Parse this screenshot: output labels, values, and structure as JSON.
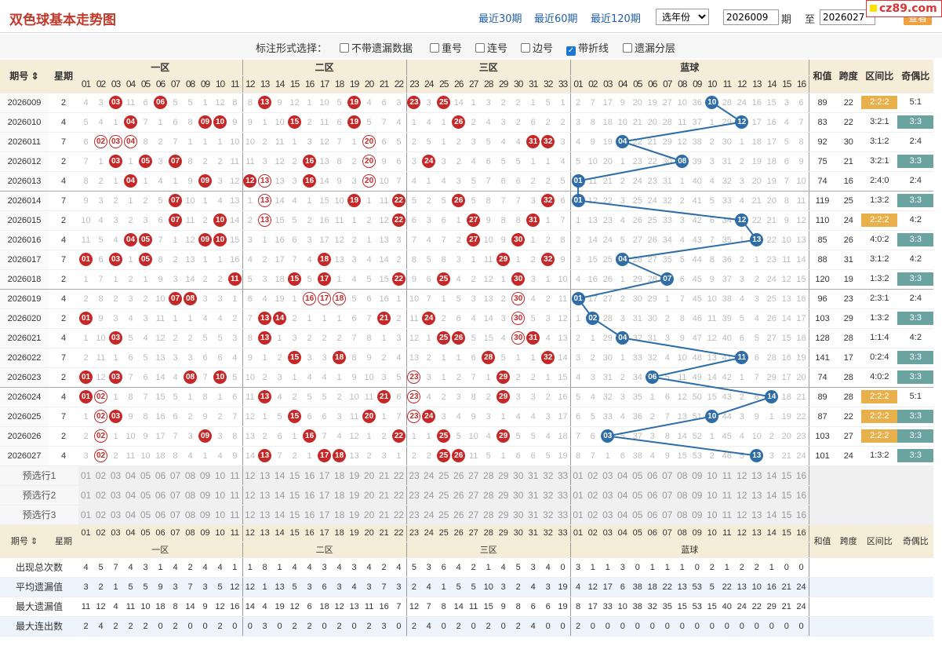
{
  "title": "双色球基本走势图",
  "nav": [
    "最近30期",
    "最近60期",
    "最近120期"
  ],
  "year_select": "选年份",
  "from": "2026009",
  "period_label": "期",
  "to_label": "至",
  "to": "2026027",
  "view": "查看",
  "site": "cz89.com",
  "opts": {
    "label": "标注形式选择：",
    "items": [
      [
        "不带遗漏数据",
        false
      ],
      [
        "重号",
        false
      ],
      [
        "连号",
        false
      ],
      [
        "边号",
        false
      ],
      [
        "带折线",
        true
      ],
      [
        "遗漏分层",
        false
      ]
    ]
  },
  "head": {
    "issue": "期号",
    "week": "星期",
    "zone1": "一区",
    "zone2": "二区",
    "zone3": "三区",
    "blue": "蓝球",
    "sum": "和值",
    "span": "跨度",
    "zone": "区间比",
    "odd": "奇偶比"
  },
  "rows": [
    {
      "i": "2026009",
      "w": "2",
      "r": "4 3 (03) 11 6 (06) 5 5 1 12 8 8 (13) 9 12 1 10 5 (19) 4 6 3 (23) 3 (25) 14 1 3 2 2 1 5 1",
      "b": "2 7 17 9 20 19 27 10 36 (10) 28 24 16 15 3 6",
      "s": "89",
      "sp": "22",
      "z": "2:2:2",
      "zg": 1,
      "o": "5:1",
      "og": 0
    },
    {
      "i": "2026010",
      "w": "4",
      "r": "5 4 1 (04) 7 1 6 8 (09) (10) 9 9 1 10 (15) 2 11 6 (19) 5 7 4 1 4 1 (26) 2 4 3 2 6 2 2",
      "b": "3 8 18 10 21 20 28 11 37 1 29 (12) 17 16 4 7",
      "s": "83",
      "sp": "22",
      "z": "3:2:1",
      "zg": 0,
      "o": "3:3",
      "og": 1
    },
    {
      "i": "2026011",
      "w": "7",
      "r": "6 [02] [03] [04] 8 2 7 1 1 1 10 10 2 11 1 3 12 7 1 [20] 6 5 2 5 1 2 3 5 4 4 (31) (32) 3",
      "b": "4 9 19 (04) 22 21 29 12 38 2 30 1 18 17 5 8",
      "s": "92",
      "sp": "30",
      "z": "3:1:2",
      "zg": 0,
      "o": "2:4",
      "og": 0
    },
    {
      "i": "2026012",
      "w": "2",
      "r": "7 1 (03) 1 (05) 3 (07) 8 2 2 11 11 3 12 2 (16) 13 8 2 [20] 9 6 3 (24) 3 2 4 6 5 5 1 1 4",
      "b": "5 10 20 1 23 22 30 (08) 39 3 31 2 19 18 6 9",
      "s": "75",
      "sp": "21",
      "z": "3:2:1",
      "zg": 0,
      "o": "3:3",
      "og": 1
    },
    {
      "i": "2026013",
      "w": "4",
      "r": "8 2 1 (04) 1 4 1 9 (09) 3 12 (12) [13] 13 3 (16) 14 9 3 [20] 10 7 4 1 4 3 5 7 6 6 2 2 5",
      "b": "(01) 11 21 2 24 23 31 1 40 4 32 3 20 19 7 10",
      "s": "74",
      "sp": "16",
      "z": "2:4:0",
      "zg": 0,
      "o": "2:4",
      "og": 0
    },
    {
      "i": "2026014",
      "w": "7",
      "r": "9 3 2 1 2 5 (07) 10 1 4 13 1 [13] 14 4 1 15 10 (19) 1 11 (22) 5 2 5 (26) 5 8 7 7 3 (32) 6",
      "b": "(01) 12 22 3 25 24 32 2 41 5 33 4 21 20 8 11",
      "s": "119",
      "sp": "25",
      "z": "1:3:2",
      "zg": 0,
      "o": "3:3",
      "og": 1
    },
    {
      "i": "2026015",
      "w": "2",
      "r": "10 4 3 2 3 6 (07) 11 2 (10) 14 2 [13] 15 5 2 16 11 1 2 12 (22) 6 3 6 1 (27) 9 8 8 (31) 1 7",
      "b": "1 13 23 4 26 25 33 3 42 6 34 (12) 22 21 9 12",
      "s": "110",
      "sp": "24",
      "z": "2:2:2",
      "zg": 1,
      "o": "4:2",
      "og": 0
    },
    {
      "i": "2026016",
      "w": "4",
      "r": "11 5 4 (04) (05) 7 1 12 (09) (10) 15 3 1 16 6 3 17 12 2 1 13 3 7 4 7 2 (27) 10 9 (30) 1 2 8",
      "b": "2 14 24 5 27 26 34 4 43 7 35 1 (13) 22 10 13",
      "s": "85",
      "sp": "26",
      "z": "4:0:2",
      "zg": 0,
      "o": "3:3",
      "og": 1
    },
    {
      "i": "2026017",
      "w": "7",
      "r": "(01) 6 (03) 1 (05) 8 2 13 1 1 16 4 2 17 7 4 (18) 13 3 4 14 2 8 5 8 3 1 11 (29) 1 2 (32) 9",
      "b": "3 15 25 (04) 28 27 35 5 44 8 36 2 1 23 11 14",
      "s": "88",
      "sp": "31",
      "z": "3:1:2",
      "zg": 0,
      "o": "4:2",
      "og": 0
    },
    {
      "i": "2026018",
      "w": "2",
      "r": "1 7 1 2 1 9 3 14 2 2 (11) 5 3 18 (15) 5 (17) 1 4 5 15 (22) 9 6 (25) 4 2 12 1 (30) 3 1 10",
      "b": "4 16 26 1 29 28 (07) 6 45 9 37 3 2 24 12 15",
      "s": "120",
      "sp": "19",
      "z": "1:3:2",
      "zg": 0,
      "o": "3:3",
      "og": 1
    },
    {
      "i": "2026019",
      "w": "4",
      "r": "2 8 2 3 2 10 (07) (08) 3 3 1 6 4 19 1 [16] [17] [18] 5 6 16 1 10 7 1 5 3 13 2 [30] 4 2 11",
      "b": "(01) 17 27 2 30 29 1 7 45 10 38 4 3 25 13 16",
      "s": "96",
      "sp": "23",
      "z": "2:3:1",
      "zg": 0,
      "o": "2:4",
      "og": 0
    },
    {
      "i": "2026020",
      "w": "2",
      "r": "(01) 9 3 4 3 11 1 1 4 4 2 7 (13) (14) 2 1 1 1 6 7 (21) 2 11 (24) 2 6 4 14 3 [30] 5 3 12",
      "b": "1 (02) 28 3 31 30 2 8 46 11 39 5 4 26 14 17",
      "s": "103",
      "sp": "29",
      "z": "1:3:2",
      "zg": 0,
      "o": "3:3",
      "og": 1
    },
    {
      "i": "2026021",
      "w": "4",
      "r": "1 10 (03) 5 4 12 2 2 5 5 3 8 (13) 1 3 2 2 2 7 8 1 3 12 1 (25) (26) 5 15 4 [30] (31) 4 13",
      "b": "2 1 29 (04) 32 31 3 9 47 12 40 6 5 27 15 18",
      "s": "128",
      "sp": "28",
      "z": "1:1:4",
      "zg": 0,
      "o": "4:2",
      "og": 0
    },
    {
      "i": "2026022",
      "w": "7",
      "r": "2 11 1 6 5 13 3 3 6 6 4 9 1 2 (15) 3 3 (18) 8 9 2 4 13 2 1 1 6 (28) 5 1 1 (32) 14",
      "b": "3 2 30 1 33 32 4 10 48 13 41 (11) 6 28 16 19",
      "s": "141",
      "sp": "17",
      "z": "0:2:4",
      "zg": 0,
      "o": "3:3",
      "og": 1
    },
    {
      "i": "2026023",
      "w": "2",
      "r": "(01) 12 (03) 7 6 14 4 (08) 7 (10) 5 10 2 3 1 4 4 1 9 10 3 5 [23] 3 1 2 7 1 (29) 2 2 1 15",
      "b": "4 3 31 2 34 (06) 5 11 49 14 42 1 7 29 17 20",
      "s": "74",
      "sp": "28",
      "z": "4:0:2",
      "zg": 0,
      "o": "3:3",
      "og": 1
    },
    {
      "i": "2026024",
      "w": "4",
      "r": "(01) [02] 1 8 7 15 5 1 8 1 6 11 (13) 4 2 5 5 2 10 11 (21) 6 [23] 4 2 3 8 2 (29) 3 3 2 16",
      "b": "5 4 32 3 35 1 6 12 50 15 43 2 8 (14) 18 21",
      "s": "89",
      "sp": "28",
      "z": "2:2:2",
      "zg": 1,
      "o": "5:1",
      "og": 0
    },
    {
      "i": "2026025",
      "w": "7",
      "r": "1 [02] (03) 9 8 16 6 2 9 2 7 12 1 5 (15) 6 6 3 11 (20) 1 7 [23] (24) 3 4 9 3 1 4 4 3 17",
      "b": "6 5 33 4 36 2 7 13 51 (10) 44 3 9 1 19 22",
      "s": "87",
      "sp": "22",
      "z": "2:2:2",
      "zg": 1,
      "o": "3:3",
      "og": 1
    },
    {
      "i": "2026026",
      "w": "2",
      "r": "2 [02] 1 10 9 17 7 3 (09) 3 8 13 2 6 1 (16) 7 4 12 1 2 (22) 1 1 (25) 5 10 4 (29) 5 5 4 18",
      "b": "7 6 (03) 5 37 3 8 14 52 1 45 4 10 2 20 23",
      "s": "103",
      "sp": "27",
      "z": "2:2:2",
      "zg": 1,
      "o": "3:3",
      "og": 1
    },
    {
      "i": "2026027",
      "w": "4",
      "r": "3 [02] 2 11 10 18 8 4 1 4 9 14 (13) 7 2 1 (17) (18) 13 2 3 1 2 2 (25) (26) 11 5 1 6 6 5 19",
      "b": "8 7 1 6 38 4 9 15 53 2 46 5 (13) 3 21 24",
      "s": "101",
      "sp": "24",
      "z": "1:3:2",
      "zg": 0,
      "o": "3:3",
      "og": 1
    }
  ],
  "pick_labels": [
    "预选行1",
    "预选行2",
    "预选行3"
  ],
  "stats": [
    {
      "label": "出现总次数",
      "r": "4 5 7 4 3 1 4 2 4 4 1 1 8 1 4 4 3 4 3 4 2 4 5 3 6 4 2 1 4 5 3 4 0",
      "b": "3 1 1 3 0 1 1 1 0 2 1 2 2 1 0 0"
    },
    {
      "label": "平均遗漏值",
      "r": "3 2 1 5 5 9 3 7 3 5 12 12 1 13 5 3 6 3 4 3 7 3 2 4 1 5 5 10 3 2 4 3 19",
      "b": "4 12 17 6 38 18 22 13 53 5 22 13 10 16 21 24"
    },
    {
      "label": "最大遗漏值",
      "r": "11 12 4 11 10 18 8 14 9 12 16 14 4 19 12 6 18 12 13 11 16 7 12 7 8 14 11 15 9 8 6 6 19",
      "b": "8 17 33 10 38 32 35 15 53 15 40 24 22 29 21 24"
    },
    {
      "label": "最大连出数",
      "r": "2 4 2 2 2 0 2 0 0 2 0 0 3 0 2 2 0 2 0 2 3 0 2 4 0 2 0 2 0 2 4 0 0",
      "b": "2 0 0 0 0 0 0 0 0 0 0 0 0 0 0 0"
    }
  ]
}
